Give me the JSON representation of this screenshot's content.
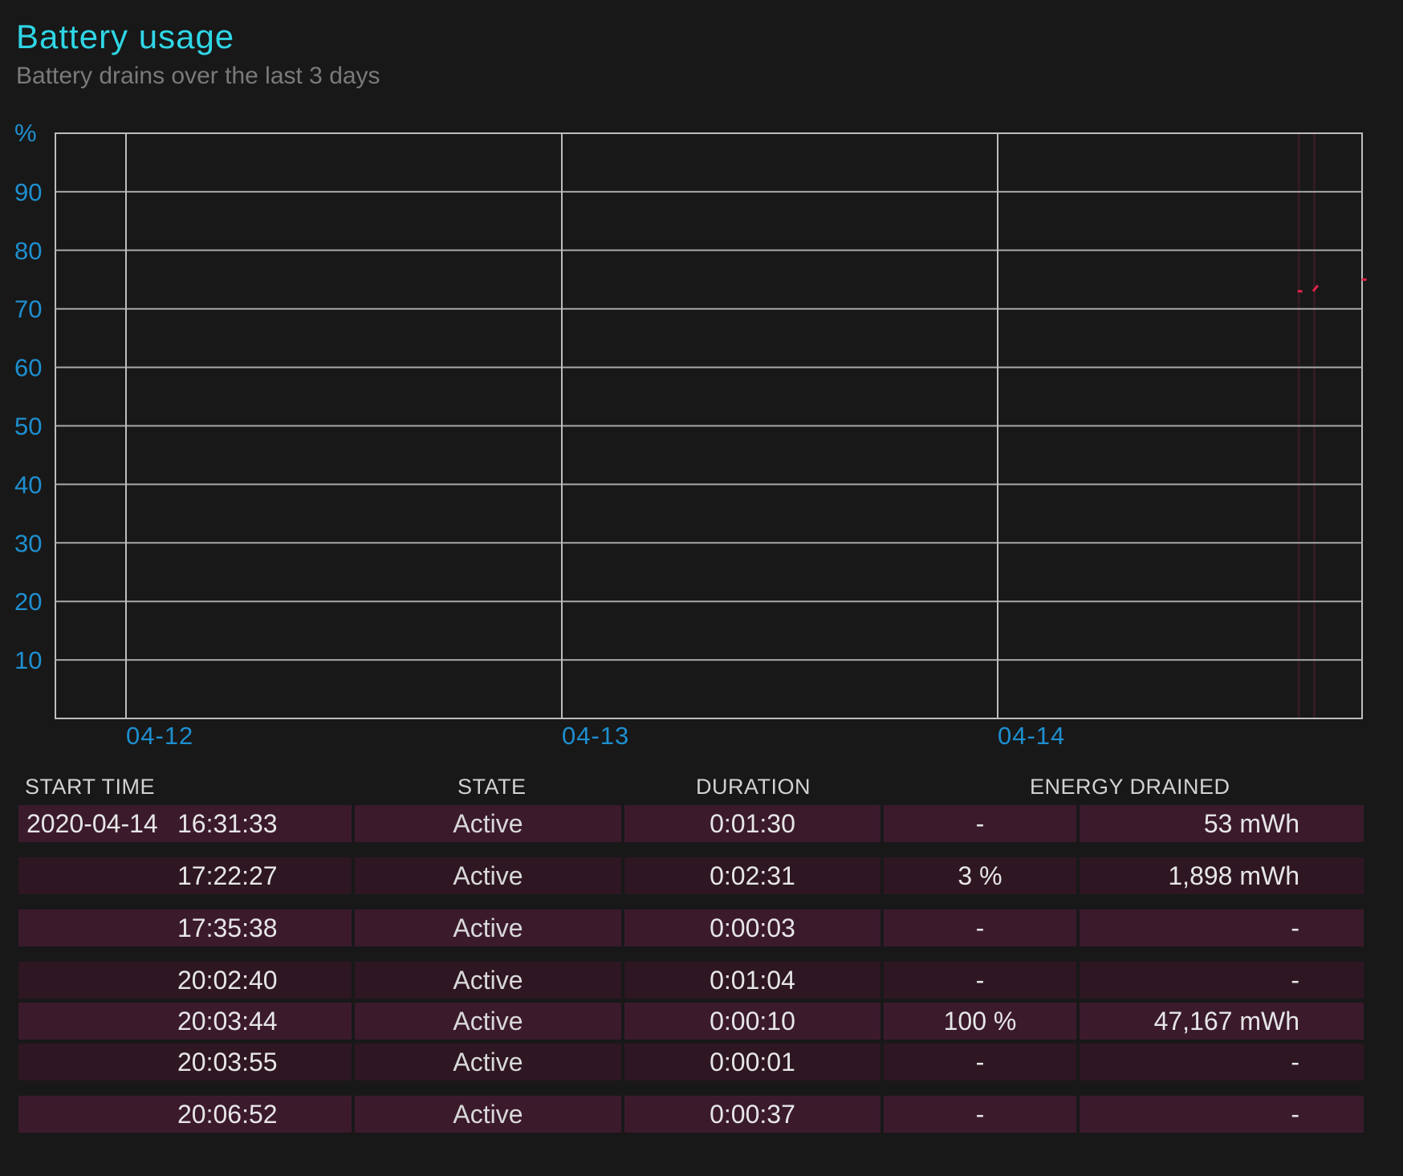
{
  "header": {
    "title": "Battery usage",
    "subtitle": "Battery drains over the last 3 days"
  },
  "chart_data": {
    "type": "line",
    "y_unit_label": "%",
    "ylim": [
      0,
      100
    ],
    "y_ticks": [
      "90",
      "80",
      "70",
      "60",
      "50",
      "40",
      "30",
      "20",
      "10"
    ],
    "x_tick_labels": [
      "04-12",
      "04-13",
      "04-14"
    ],
    "grid": true,
    "series_color": "#e0234a",
    "series": [
      {
        "points": [
          {
            "time": "04-14 16:31",
            "percent": 73
          },
          {
            "time": "04-14 16:33",
            "percent": 73
          },
          {
            "time": "04-14 17:22",
            "percent": 73
          },
          {
            "time": "04-14 17:25",
            "percent": 74
          }
        ]
      },
      {
        "points": [
          {
            "time": "04-14 20:03",
            "percent": 75
          },
          {
            "time": "04-14 20:06",
            "percent": 75
          }
        ]
      }
    ],
    "active_bands": [
      {
        "start": "04-14 16:31",
        "end": "04-14 16:33"
      },
      {
        "start": "04-14 17:22",
        "end": "04-14 17:25"
      }
    ]
  },
  "table": {
    "columns": [
      "START TIME",
      "STATE",
      "DURATION",
      "ENERGY DRAINED"
    ],
    "rows": [
      {
        "date": "2020-04-14",
        "time": "16:31:33",
        "state": "Active",
        "duration": "0:01:30",
        "percent": "-",
        "energy": "53 mWh"
      },
      {
        "date": "",
        "time": "17:22:27",
        "state": "Active",
        "duration": "0:02:31",
        "percent": "3 %",
        "energy": "1,898 mWh"
      },
      {
        "date": "",
        "time": "17:35:38",
        "state": "Active",
        "duration": "0:00:03",
        "percent": "-",
        "energy": "-"
      },
      {
        "date": "",
        "time": "20:02:40",
        "state": "Active",
        "duration": "0:01:04",
        "percent": "-",
        "energy": "-"
      },
      {
        "date": "",
        "time": "20:03:44",
        "state": "Active",
        "duration": "0:00:10",
        "percent": "100 %",
        "energy": "47,167 mWh"
      },
      {
        "date": "",
        "time": "20:03:55",
        "state": "Active",
        "duration": "0:00:01",
        "percent": "-",
        "energy": "-"
      },
      {
        "date": "",
        "time": "20:06:52",
        "state": "Active",
        "duration": "0:00:37",
        "percent": "-",
        "energy": "-"
      }
    ]
  }
}
